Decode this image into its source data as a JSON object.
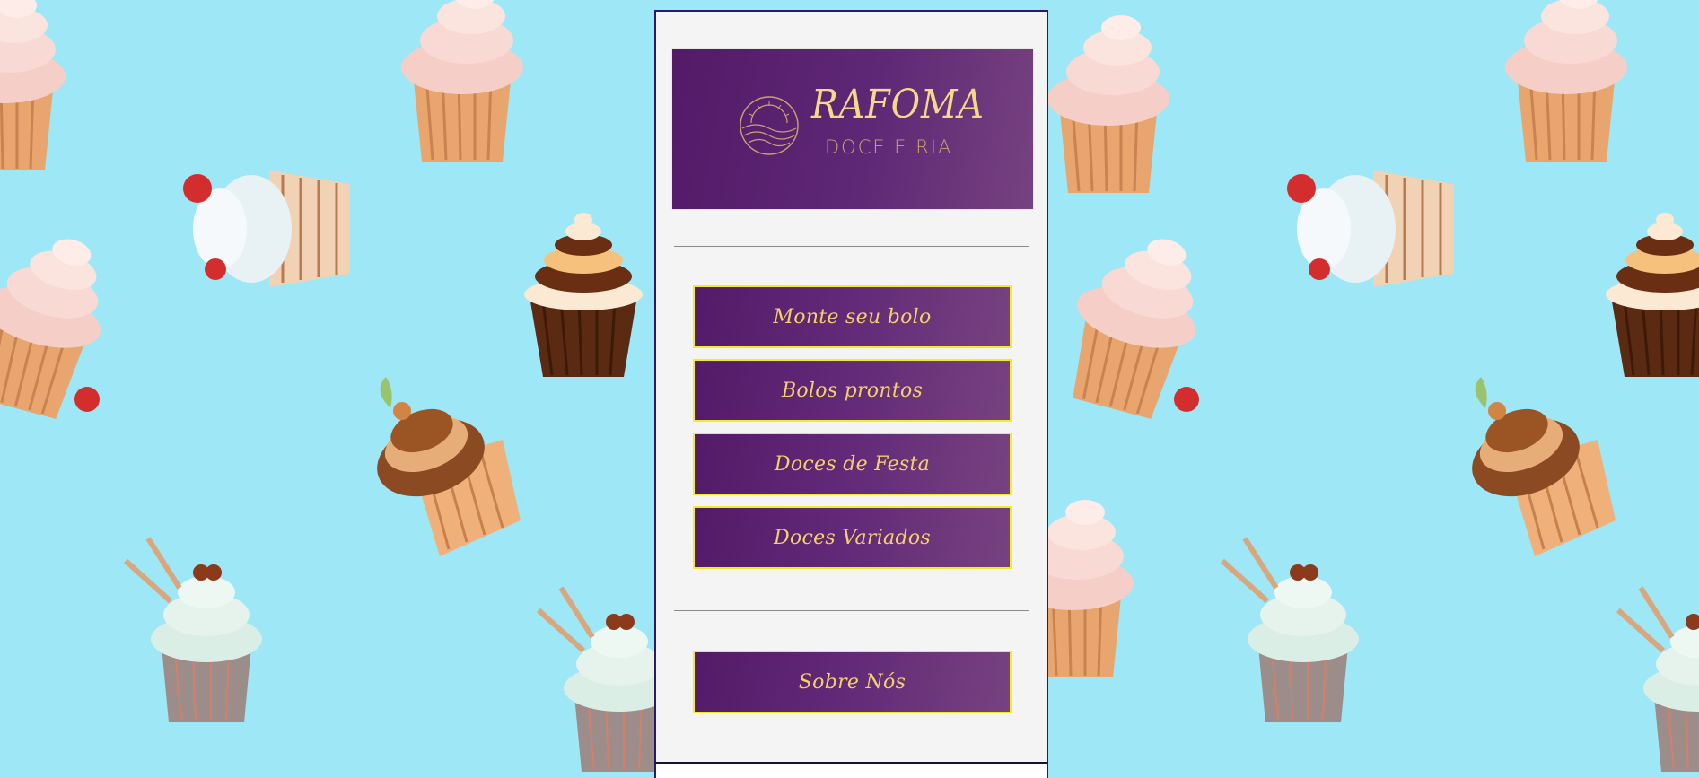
{
  "brand": {
    "name": "RAFOMA",
    "subtitle": "DOCE E RIA"
  },
  "nav": {
    "items": [
      {
        "label": "Monte seu bolo"
      },
      {
        "label": "Bolos prontos"
      },
      {
        "label": "Doces de Festa"
      },
      {
        "label": "Doces Variados"
      }
    ],
    "about": {
      "label": "Sobre Nós"
    }
  },
  "background": {
    "pattern": "cupcake-pattern",
    "color": "#9de7f6"
  },
  "colors": {
    "panel": "#f4f4f4",
    "button_gradient_start": "#521a67",
    "button_gradient_end": "#77427f",
    "button_border": "#f3ea2a",
    "button_text": "#f4d06a",
    "logo_text": "#f4d98a"
  }
}
